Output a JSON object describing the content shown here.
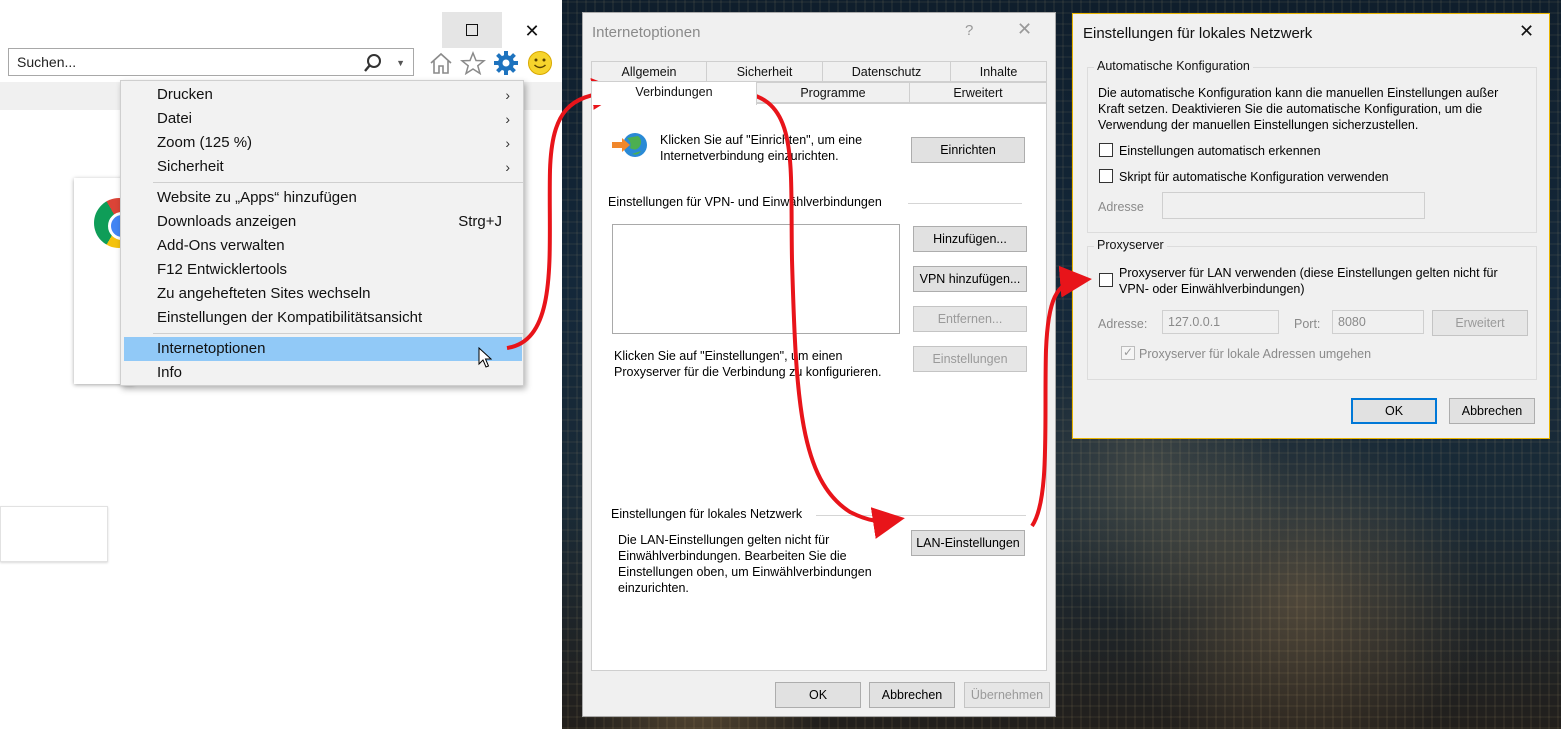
{
  "browser": {
    "search_placeholder": "Suchen...",
    "icons": [
      "search-icon",
      "home-icon",
      "star-icon",
      "gear-icon",
      "smiley-icon"
    ],
    "accent_color": "#1e73be"
  },
  "menu": {
    "items": [
      {
        "label": "Drucken",
        "submenu": true
      },
      {
        "label": "Datei",
        "submenu": true
      },
      {
        "label": "Zoom (125 %)",
        "submenu": true
      },
      {
        "label": "Sicherheit",
        "submenu": true
      },
      {
        "label": "Website zu „Apps“ hinzufügen"
      },
      {
        "label": "Downloads anzeigen",
        "shortcut": "Strg+J"
      },
      {
        "label": "Add-Ons verwalten"
      },
      {
        "label": "F12 Entwicklertools"
      },
      {
        "label": "Zu angehefteten Sites wechseln"
      },
      {
        "label": "Einstellungen der Kompatibilitätsansicht"
      },
      {
        "label": "Internetoptionen",
        "highlighted": true
      },
      {
        "label": "Info"
      }
    ],
    "highlight_color": "#91c9f7"
  },
  "inet_dialog": {
    "title": "Internetoptionen",
    "help": "?",
    "close": "✕",
    "tabs_row1": [
      "Allgemein",
      "Sicherheit",
      "Datenschutz",
      "Inhalte"
    ],
    "tabs_row2": [
      "Verbindungen",
      "Programme",
      "Erweitert"
    ],
    "active_tab": "Verbindungen",
    "setup_text": "Klicken Sie auf \"Einrichten\", um eine Internetverbindung einzurichten.",
    "setup_button": "Einrichten",
    "vpn_section": "Einstellungen für VPN- und Einwählverbindungen",
    "add_button": "Hinzufügen...",
    "vpn_add_button": "VPN hinzufügen...",
    "remove_button": "Entfernen...",
    "proxy_text": "Klicken Sie auf \"Einstellungen\", um einen Proxyserver für die Verbindung zu konfigurieren.",
    "settings_button": "Einstellungen",
    "lan_section": "Einstellungen für lokales Netzwerk",
    "lan_text": "Die LAN-Einstellungen gelten nicht für Einwählverbindungen. Bearbeiten Sie die Einstellungen oben, um Einwählverbindungen einzurichten.",
    "lan_button": "LAN-Einstellungen",
    "ok_button": "OK",
    "cancel_button": "Abbrechen",
    "apply_button": "Übernehmen"
  },
  "lan_dialog": {
    "title": "Einstellungen für lokales Netzwerk",
    "close": "✕",
    "auto_group": "Automatische Konfiguration",
    "auto_text": "Die automatische Konfiguration kann die manuellen Einstellungen außer Kraft setzen. Deaktivieren Sie die automatische Konfiguration, um die Verwendung der manuellen Einstellungen sicherzustellen.",
    "auto_detect": "Einstellungen automatisch erkennen",
    "auto_detect_checked": false,
    "script": "Skript für automatische Konfiguration verwenden",
    "script_checked": false,
    "address_label": "Adresse",
    "address_value": "",
    "proxy_group": "Proxyserver",
    "use_proxy": "Proxyserver für LAN verwenden (diese Einstellungen gelten nicht für VPN- oder Einwählverbindungen)",
    "use_proxy_checked": false,
    "proxy_address_label": "Adresse:",
    "proxy_address": "127.0.0.1",
    "port_label": "Port:",
    "port": "8080",
    "advanced_button": "Erweitert",
    "bypass_local": "Proxyserver für lokale Adressen umgehen",
    "bypass_local_checked": true,
    "ok_button": "OK",
    "cancel_button": "Abbrechen"
  },
  "annotation_color": "#e8141a"
}
